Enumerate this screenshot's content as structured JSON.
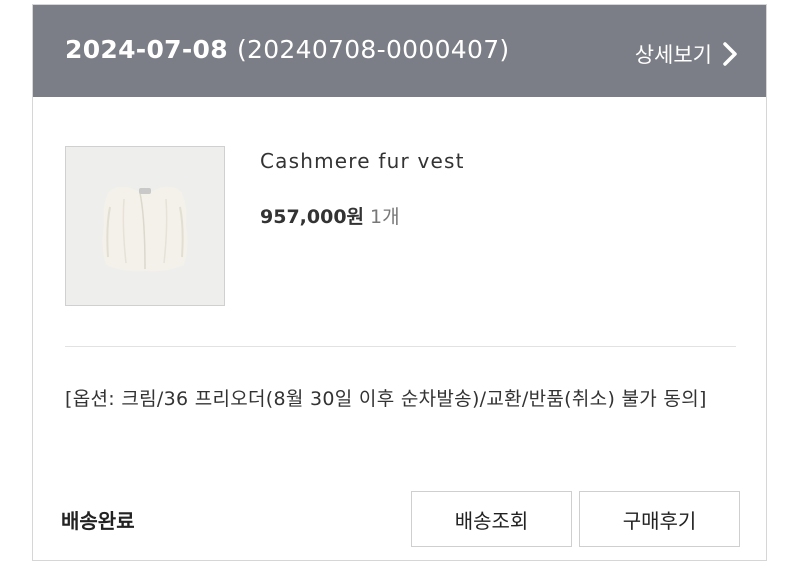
{
  "order": {
    "date": "2024-07-08",
    "number": "(20240708-0000407)",
    "detail_label": "상세보기"
  },
  "product": {
    "name": "Cashmere fur vest",
    "price": "957,000원",
    "quantity": "1개",
    "option": "[옵션: 크림/36 프리오더(8월 30일 이후 순차발송)/교환/반품(취소) 불가 동의]"
  },
  "status": "배송완료",
  "buttons": {
    "tracking": "배송조회",
    "review": "구매후기"
  },
  "colors": {
    "header_bg": "#7b7e86",
    "thumb_bg": "#eeeeec",
    "product_color": "#f3f1ea"
  },
  "icons": {
    "detail": "chevron-right-icon"
  }
}
